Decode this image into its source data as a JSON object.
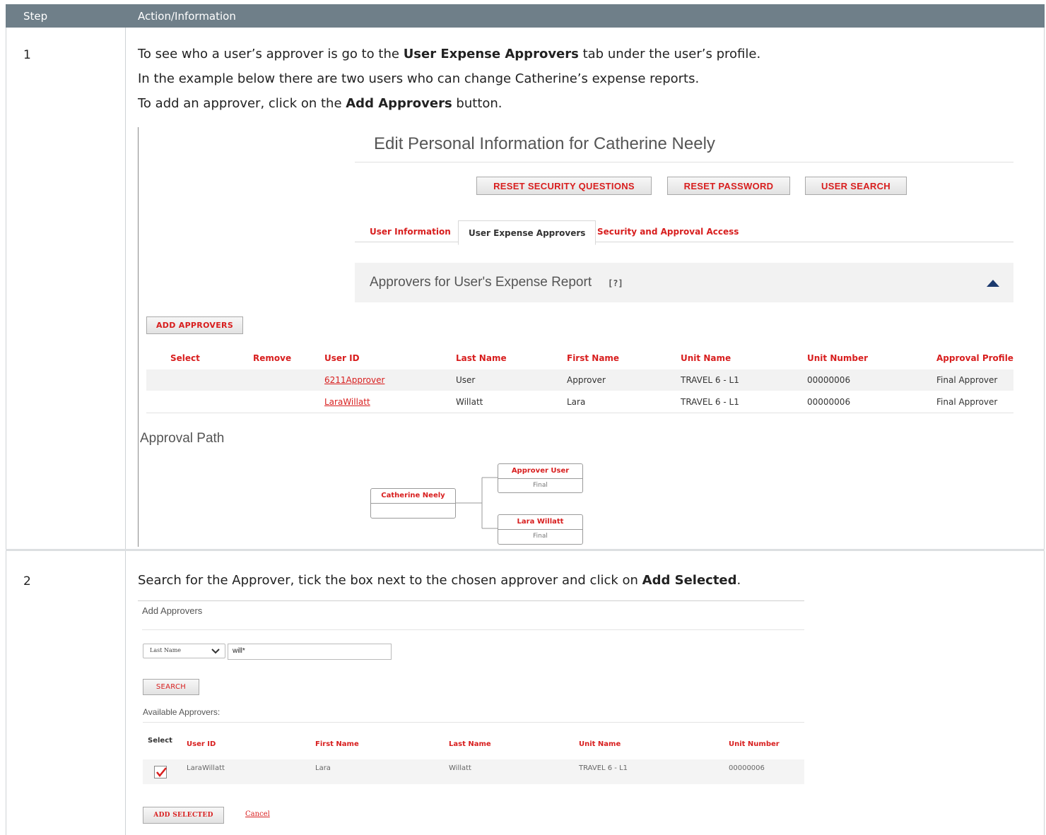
{
  "header": {
    "col_step": "Step",
    "col_action": "Action/Information"
  },
  "step1": {
    "number": "1",
    "line1_pre": "To see who a user’s approver is go to the ",
    "line1_bold": "User Expense Approvers",
    "line1_post": " tab under the user’s profile.",
    "line2": "In the example below there are two users who can change Catherine’s expense reports.",
    "line3_pre": "To add an approver, click on the ",
    "line3_bold": "Add Approvers",
    "line3_post": " button.",
    "screen": {
      "title": "Edit Personal Information for Catherine Neely",
      "buttons": {
        "reset_security": "RESET SECURITY QUESTIONS",
        "reset_password": "RESET PASSWORD",
        "user_search": "USER SEARCH"
      },
      "tabs": {
        "user_info": "User Information",
        "expense_approvers": "User Expense Approvers",
        "security_access": "Security and Approval Access"
      },
      "section_title": "Approvers for User's Expense Report",
      "help_marker": "[?]",
      "add_approvers": "ADD APPROVERS",
      "columns": [
        "Select",
        "Remove",
        "User ID",
        "Last Name",
        "First Name",
        "Unit Name",
        "Unit Number",
        "Approval Profile"
      ],
      "rows": [
        {
          "user_id": "6211Approver",
          "last": "User",
          "first": "Approver",
          "unit": "TRAVEL 6 - L1",
          "unit_no": "00000006",
          "profile": "Final Approver"
        },
        {
          "user_id": "LaraWillatt",
          "last": "Willatt",
          "first": "Lara",
          "unit": "TRAVEL 6 - L1",
          "unit_no": "00000006",
          "profile": "Final Approver"
        }
      ],
      "approval_path_title": "Approval Path",
      "path": {
        "root": "Catherine Neely",
        "approver1": {
          "name": "Approver User",
          "level": "Final"
        },
        "approver2": {
          "name": "Lara Willatt",
          "level": "Final"
        }
      }
    }
  },
  "step2": {
    "number": "2",
    "line_pre": "Search for the Approver, tick the box next to the chosen approver and click on ",
    "line_bold": "Add Selected",
    "line_post": ".",
    "screen": {
      "title": "Add Approvers",
      "search_field": "Last Name",
      "search_value": "will*",
      "search_button": "SEARCH",
      "available_label": "Available Approvers:",
      "columns": [
        "Select",
        "User ID",
        "First Name",
        "Last Name",
        "Unit Name",
        "Unit Number"
      ],
      "row": {
        "user_id": "LaraWillatt",
        "first": "Lara",
        "last": "Willatt",
        "unit": "TRAVEL 6 - L1",
        "unit_no": "00000006"
      },
      "add_selected": "ADD SELECTED",
      "cancel": "Cancel"
    }
  }
}
